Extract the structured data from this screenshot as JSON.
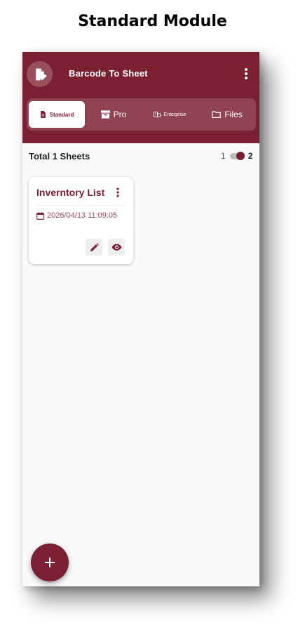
{
  "page": {
    "heading": "Standard Module"
  },
  "app": {
    "title": "Barcode To Sheet",
    "logo_icon": "document-edit-icon",
    "menu_icon": "more-vertical-icon"
  },
  "tabs": [
    {
      "label": "Standard",
      "icon": "document-icon",
      "active": true
    },
    {
      "label": "Pro",
      "icon": "archive-box-icon",
      "active": false
    },
    {
      "label": "Enterprise",
      "icon": "building-icon",
      "active": false
    },
    {
      "label": "Files",
      "icon": "folder-icon",
      "active": false
    }
  ],
  "summary": {
    "text": "Total 1 Sheets",
    "layout_option_1": "1",
    "layout_option_2": "2",
    "selected_layout": "2"
  },
  "sheets": [
    {
      "title": "Inverntory List",
      "date": "2026/04/13 11:09:05",
      "date_icon": "calendar-icon",
      "menu_icon": "more-vertical-icon",
      "edit_icon": "pencil-icon",
      "view_icon": "eye-icon"
    }
  ],
  "fab": {
    "icon": "plus-icon"
  },
  "colors": {
    "brand": "#7b1f32",
    "background": "#fafafa",
    "card": "#ffffff",
    "date_text": "#9a4a5b"
  }
}
